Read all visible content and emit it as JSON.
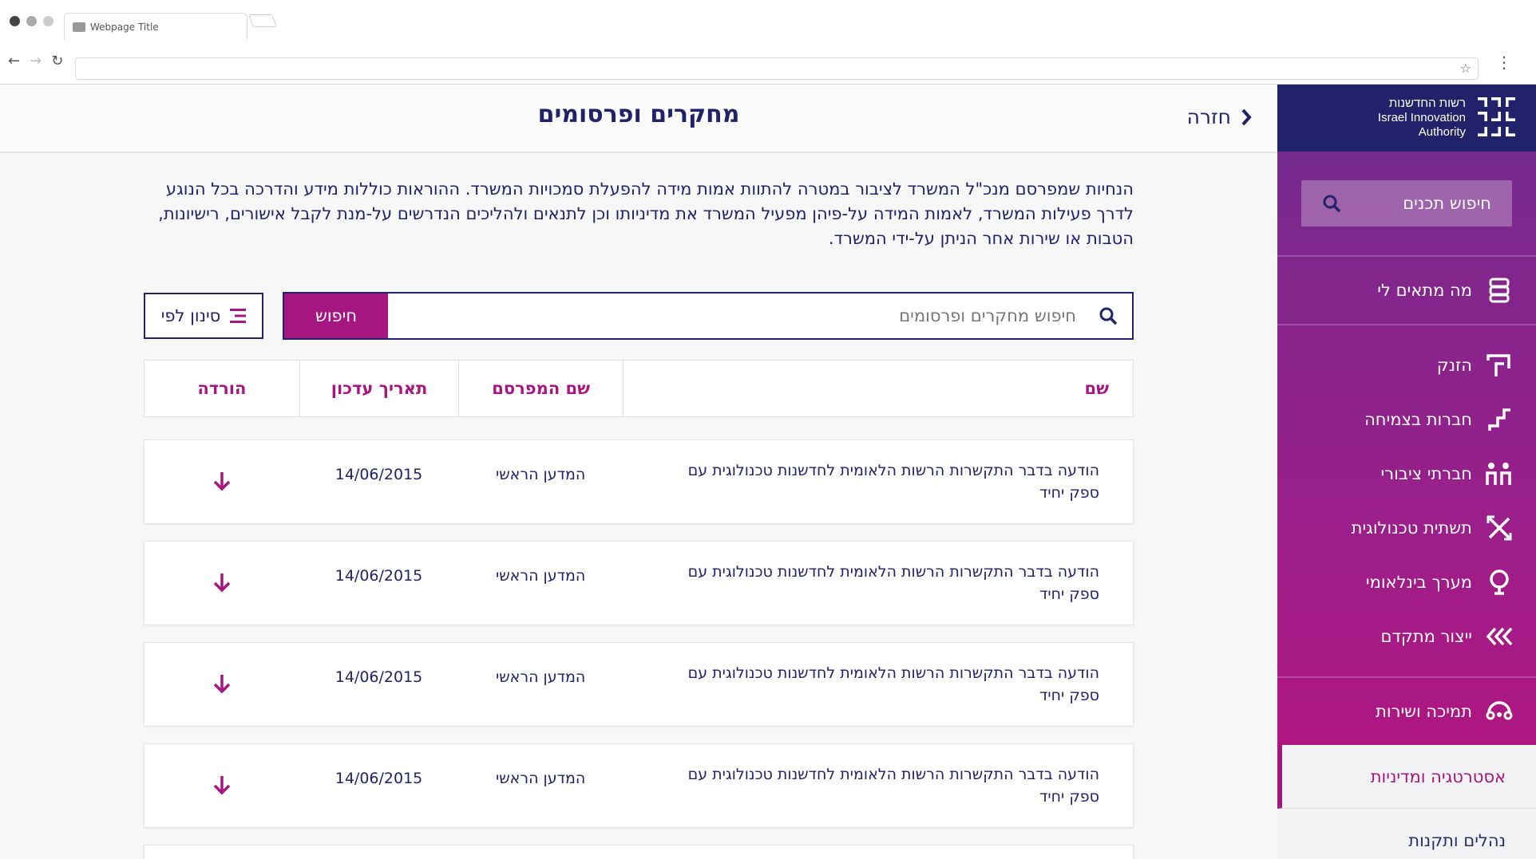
{
  "browser": {
    "tab_title": "Webpage Title",
    "address": ""
  },
  "header": {
    "title": "מחקרים ופרסומים",
    "back_label": "חזרה"
  },
  "intro": "הנחיות שמפרסם מנכ\"ל המשרד לציבור במטרה להתוות אמות מידה להפעלת סמכויות המשרד. ההוראות כוללות מידע והדרכה בכל הנוגע לדרך פעילות המשרד, לאמות המידה על-פיהן מפעיל המשרד את מדיניותו וכן לתנאים ולהליכים הנדרשים על-מנת לקבל אישורים, רישיונות, הטבות או שירות אחר הניתן על-ידי המשרד.",
  "search": {
    "placeholder": "חיפוש מחקרים ופרסומים",
    "button_label": "חיפוש",
    "filter_label": "סינון לפי"
  },
  "table": {
    "columns": [
      "שם",
      "שם המפרסם",
      "תאריך עדכון",
      "הורדה"
    ],
    "rows": [
      {
        "name": "הודעה בדבר התקשרות הרשות הלאומית לחדשנות טכנולוגית עם ספק יחיד",
        "publisher": "המדען הראשי",
        "date": "14/06/2015"
      },
      {
        "name": "הודעה בדבר התקשרות הרשות הלאומית לחדשנות טכנולוגית עם ספק יחיד",
        "publisher": "המדען הראשי",
        "date": "14/06/2015"
      },
      {
        "name": "הודעה בדבר התקשרות הרשות הלאומית לחדשנות טכנולוגית עם ספק יחיד",
        "publisher": "המדען הראשי",
        "date": "14/06/2015"
      },
      {
        "name": "הודעה בדבר התקשרות הרשות הלאומית לחדשנות טכנולוגית עם ספק יחיד",
        "publisher": "המדען הראשי",
        "date": "14/06/2015"
      }
    ]
  },
  "sidebar": {
    "brand_he": "רשות החדשנות",
    "brand_en_1": "Israel Innovation",
    "brand_en_2": "Authority",
    "search_label": "חיפוש תכנים",
    "items": [
      {
        "label": "מה מתאים לי",
        "icon": "stack-icon"
      },
      {
        "label": "הזנק",
        "icon": "launch-icon"
      },
      {
        "label": "חברות בצמיחה",
        "icon": "stairs-icon"
      },
      {
        "label": "חברתי ציבורי",
        "icon": "people-icon"
      },
      {
        "label": "תשתית טכנולוגית",
        "icon": "cross-arrows-icon"
      },
      {
        "label": "מערך בינלאומי",
        "icon": "globe-pin-icon"
      },
      {
        "label": "ייצור מתקדם",
        "icon": "double-chevron-icon"
      },
      {
        "label": "תמיכה ושירות",
        "icon": "headset-icon"
      }
    ],
    "active_item": "אסטרטגיה ומדיניות",
    "light_item": "נהלים ותקנות"
  },
  "colors": {
    "navy": "#22226a",
    "magenta": "#a51680",
    "purple": "#6e2c8e"
  }
}
